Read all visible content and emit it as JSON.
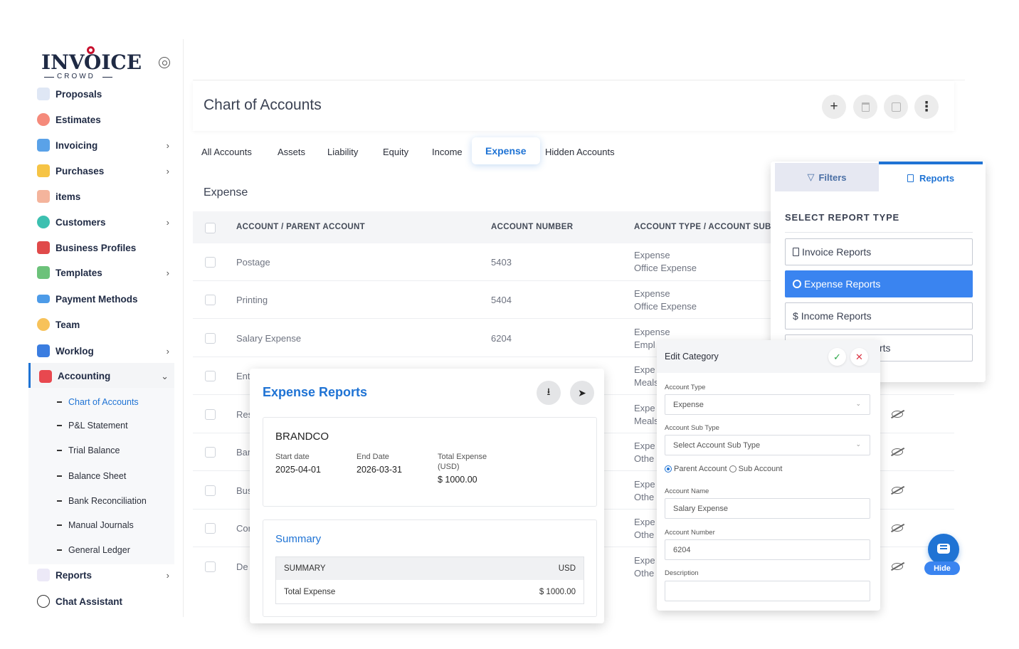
{
  "brand": {
    "name": "INVOICE",
    "sub": "CROWD"
  },
  "sidebar": {
    "items": [
      {
        "label": "Proposals",
        "icon": "document-icon",
        "chevron": ""
      },
      {
        "label": "Estimates",
        "icon": "pie-chart-icon",
        "chevron": ""
      },
      {
        "label": "Invoicing",
        "icon": "invoice-icon",
        "chevron": "›"
      },
      {
        "label": "Purchases",
        "icon": "shopping-bag-icon",
        "chevron": "›"
      },
      {
        "label": "items",
        "icon": "box-icon",
        "chevron": ""
      },
      {
        "label": "Customers",
        "icon": "users-icon",
        "chevron": "›"
      },
      {
        "label": "Business Profiles",
        "icon": "briefcase-icon",
        "chevron": ""
      },
      {
        "label": "Templates",
        "icon": "template-icon",
        "chevron": "›"
      },
      {
        "label": "Payment Methods",
        "icon": "credit-card-icon",
        "chevron": ""
      },
      {
        "label": "Team",
        "icon": "team-icon",
        "chevron": ""
      },
      {
        "label": "Worklog",
        "icon": "calendar-icon",
        "chevron": "›"
      },
      {
        "label": "Accounting",
        "icon": "calculator-icon",
        "chevron": "⌄"
      },
      {
        "label": "Reports",
        "icon": "reports-icon",
        "chevron": "›"
      },
      {
        "label": "Chat Assistant",
        "icon": "chat-icon",
        "chevron": ""
      }
    ],
    "accounting_sub": [
      "Chart of Accounts",
      "P&L Statement",
      "Trial Balance",
      "Balance Sheet",
      "Bank Reconciliation",
      "Manual Journals",
      "General Ledger"
    ]
  },
  "header": {
    "title": "Chart of Accounts",
    "add": "+",
    "more": "⋮"
  },
  "tabs": [
    "All Accounts",
    "Assets",
    "Liability",
    "Equity",
    "Income",
    "Expense",
    "Hidden Accounts"
  ],
  "table": {
    "title": "Expense",
    "headers": [
      "ACCOUNT / PARENT ACCOUNT",
      "ACCOUNT NUMBER",
      "ACCOUNT TYPE / ACCOUNT SUB"
    ],
    "rows": [
      {
        "name": "Postage",
        "number": "5403",
        "type": "Expense",
        "sub": "Office Expense"
      },
      {
        "name": "Printing",
        "number": "5404",
        "type": "Expense",
        "sub": "Office Expense"
      },
      {
        "name": "Salary Expense",
        "number": "6204",
        "type": "Expense",
        "sub": "Empl"
      },
      {
        "name": "Ent",
        "number": "",
        "type": "Expe",
        "sub": "Meals"
      },
      {
        "name": "Res",
        "number": "",
        "type": "Expe",
        "sub": "Meals"
      },
      {
        "name": "Ban",
        "number": "",
        "type": "Expe",
        "sub": "Othe"
      },
      {
        "name": "Bus",
        "number": "",
        "type": "Expe",
        "sub": "Othe"
      },
      {
        "name": "Cor",
        "number": "",
        "type": "Expe",
        "sub": "Othe"
      },
      {
        "name": "De",
        "number": "",
        "type": "Expe",
        "sub": "Othe"
      }
    ]
  },
  "reports_panel": {
    "tab_filters": "Filters",
    "tab_reports": "Reports",
    "heading": "SELECT REPORT TYPE",
    "options": [
      "Invoice Reports",
      "Expense Reports",
      "Income Reports",
      "rts"
    ],
    "selected": "Expense Reports"
  },
  "edit_category": {
    "title": "Edit Category",
    "account_type_label": "Account Type",
    "account_type_value": "Expense",
    "sub_type_label": "Account Sub Type",
    "sub_type_placeholder": "Select Account Sub Type",
    "radio_parent": "Parent Account",
    "radio_sub": "Sub Account",
    "name_label": "Account Name",
    "name_value": "Salary Expense",
    "number_label": "Account Number",
    "number_value": "6204",
    "description_label": "Description",
    "description_value": ""
  },
  "expense_report": {
    "title": "Expense Reports",
    "company": "BRANDCO",
    "start_label": "Start date",
    "start_value": "2025-04-01",
    "end_label": "End Date",
    "end_value": "2026-03-31",
    "total_label_1": "Total Expense",
    "total_label_2": "(USD)",
    "total_value": "$ 1000.00",
    "summary_title": "Summary",
    "summary_col1": "SUMMARY",
    "summary_col2": "USD",
    "summary_row_label": "Total Expense",
    "summary_row_value": "$ 1000.00"
  },
  "chat": {
    "hide_label": "Hide"
  },
  "colors": {
    "accent": "#1f73d4",
    "selected": "#3a84f0",
    "navy": "#1f2a44"
  }
}
